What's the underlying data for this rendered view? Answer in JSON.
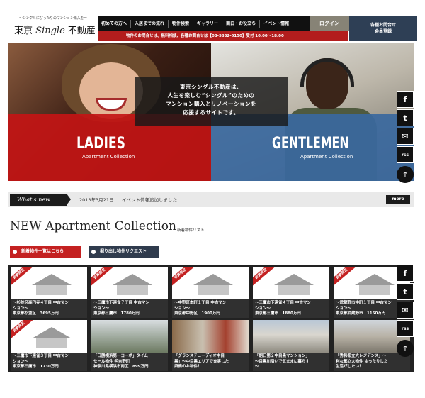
{
  "logo": {
    "tagline": "〜シングルにぴったりのマンション購入を〜",
    "name_pre": "東京",
    "name_script": "Single",
    "name_post": "不動産"
  },
  "nav": {
    "items": [
      "初めての方へ",
      "入居までの流れ",
      "物件検索",
      "ギャラリー",
      "面白・お役立ち",
      "イベント情報"
    ]
  },
  "notice": "物件のお問合せは、無料相談、各種お問合せは【03-5832-6150】受付 10:00〜18:00",
  "login_label": "ログイン",
  "register_label": [
    "各種お問合せ",
    "会員登録"
  ],
  "hero": {
    "message": [
      "東京シングル不動産は、",
      "人生を楽しむ“シングル”のための",
      "マンション購入とリノベーションを",
      "応援するサイトです。"
    ],
    "ladies_title": "LADIES",
    "ladies_sub": "Apartment Collection",
    "gentlemen_title": "GENTLEMEN",
    "gentlemen_sub": "Apartment Collection"
  },
  "social": [
    "f",
    "t",
    "✉",
    "rss",
    "↑"
  ],
  "news": {
    "label": "What's new",
    "date": "2013年3月21日",
    "text": "イベント情報追加しました！",
    "more": "more"
  },
  "section": {
    "title": "NEW Apartment Collection",
    "subtitle": "新着物件リスト",
    "btn_new": "新着物件一覧はこちら",
    "btn_request": "掘り出し物件リクエスト"
  },
  "ribbon": "会員限定",
  "cards": [
    {
      "caption": [
        "〜杉並区高円寺４丁目 中古マン",
        "ション〜",
        "東京都杉並区　3695万円"
      ]
    },
    {
      "caption": [
        "〜三鷹市下連雀７丁目 中古マン",
        "ション〜",
        "東京都三鷹市　1780万円"
      ]
    },
    {
      "caption": [
        "〜中野区本町１丁目 中古マン",
        "ション〜",
        "東京都中野区　1900万円"
      ]
    },
    {
      "caption": [
        "〜三鷹市下連雀４丁目 中古マン",
        "ション〜",
        "東京都三鷹市　1880万円"
      ]
    },
    {
      "caption": [
        "〜武蔵野市中町１丁目 中古マン",
        "ション〜",
        "東京都武蔵野市　1150万円"
      ]
    },
    {
      "caption": [
        "〜三鷹市下連雀３丁目 中古マン",
        "ション〜",
        "東京都三鷹市　1730万円"
      ]
    },
    {
      "caption": [
        "「日勝横浜第一コーポ」タイム",
        "セール物件 ＠吉野町",
        "神奈川県横浜市南区　899万円"
      ]
    },
    {
      "caption": [
        "「グランステューディオ中目",
        "黒」〜中目黒エリアで充実した",
        "設備のお物件！"
      ]
    },
    {
      "caption": [
        "「朝日第２中目黒マンション」",
        "〜目黒川沿いで気ままに暮らす",
        "〜"
      ]
    },
    {
      "caption": [
        "「秀和都立大レジデンス」〜",
        "利な都立大物件 ゆったりした",
        "生活がしたい！"
      ]
    }
  ]
}
